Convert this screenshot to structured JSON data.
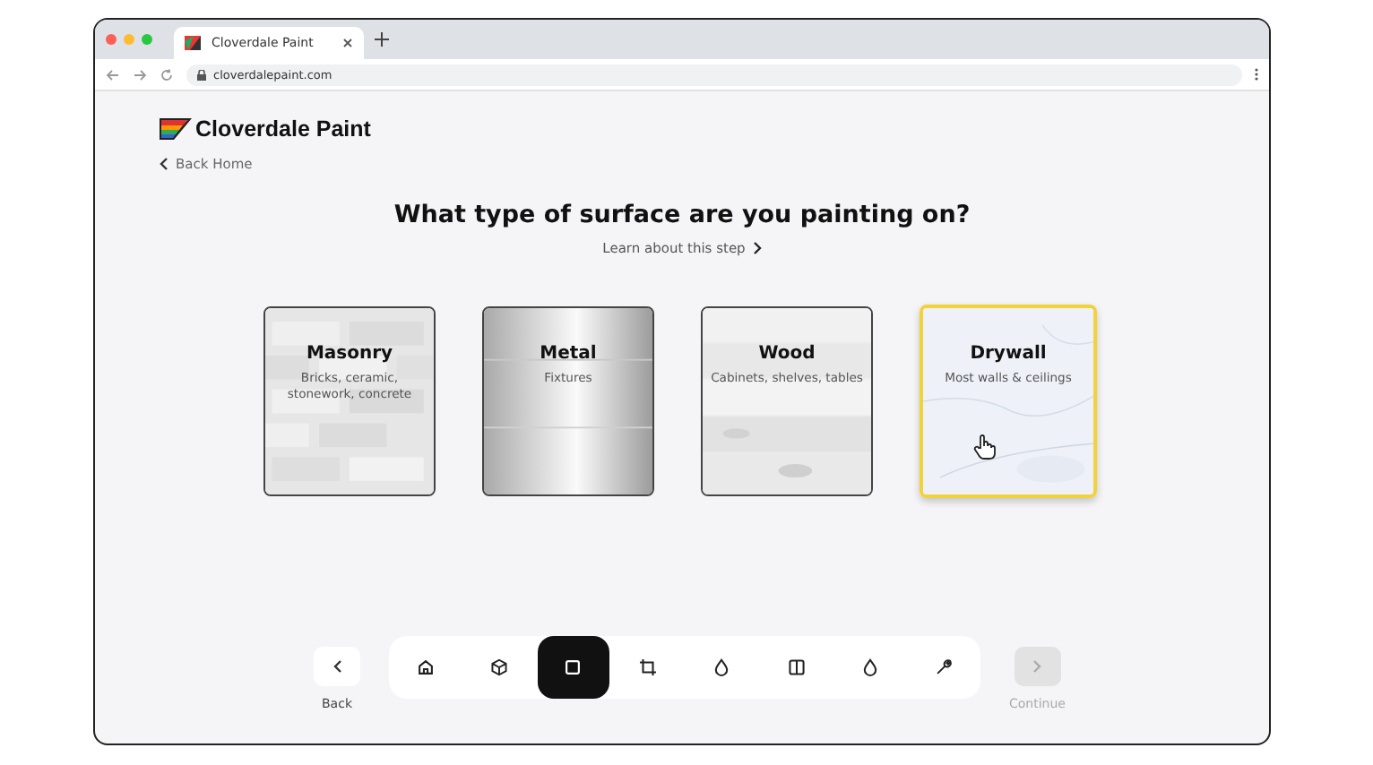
{
  "browser": {
    "tab_title": "Cloverdale Paint",
    "url": "cloverdalepaint.com"
  },
  "brand": "Cloverdale Paint",
  "back_link": "Back Home",
  "heading": "What type of surface are you painting on?",
  "learn_link": "Learn about this step",
  "surfaces": [
    {
      "kind": "masonry",
      "name": "Masonry",
      "description": "Bricks, ceramic, stonework, concrete",
      "selected": false
    },
    {
      "kind": "metal",
      "name": "Metal",
      "description": "Fixtures",
      "selected": false
    },
    {
      "kind": "wood",
      "name": "Wood",
      "description": "Cabinets, shelves, tables",
      "selected": false
    },
    {
      "kind": "drywall",
      "name": "Drywall",
      "description": "Most walls & ceilings",
      "selected": true
    }
  ],
  "steps": [
    {
      "kind": "home",
      "selected": false
    },
    {
      "kind": "cube",
      "selected": false
    },
    {
      "kind": "square",
      "selected": true
    },
    {
      "kind": "crop",
      "selected": false
    },
    {
      "kind": "drop",
      "selected": false
    },
    {
      "kind": "columns",
      "selected": false
    },
    {
      "kind": "drop",
      "selected": false
    },
    {
      "kind": "wrench",
      "selected": false
    }
  ],
  "back_button": {
    "label": "Back"
  },
  "continue_button": {
    "label": "Continue",
    "disabled": true
  }
}
